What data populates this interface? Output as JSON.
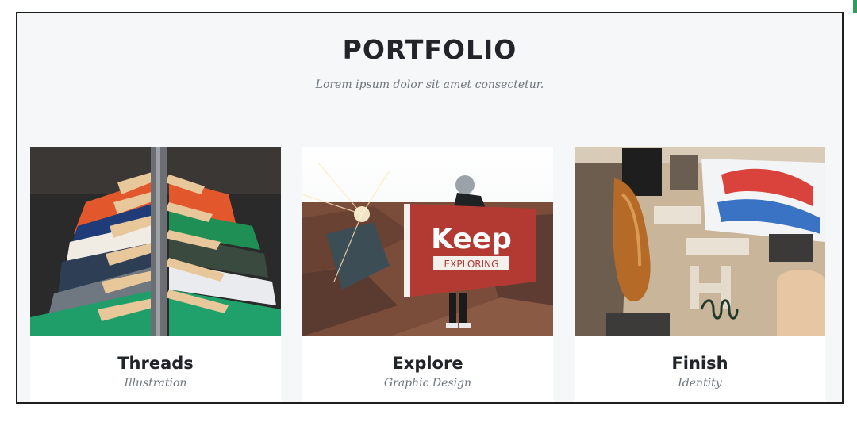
{
  "section": {
    "heading": "PORTFOLIO",
    "subheading": "Lorem ipsum dolor sit amet consectetur."
  },
  "portfolio_items": [
    {
      "title": "Threads",
      "category": "Illustration",
      "image": "clothes-on-hangers-image"
    },
    {
      "title": "Explore",
      "category": "Graphic Design",
      "image": "keep-exploring-flag-image",
      "image_text": [
        "Keep",
        "EXPLORING"
      ]
    },
    {
      "title": "Finish",
      "category": "Identity",
      "image": "workshop-letters-image"
    }
  ],
  "colors": {
    "heading": "#212529",
    "muted": "#6c757d",
    "section_bg": "#f6f7f9",
    "card_bg": "#ffffff",
    "flag_red": "#b33a33"
  }
}
